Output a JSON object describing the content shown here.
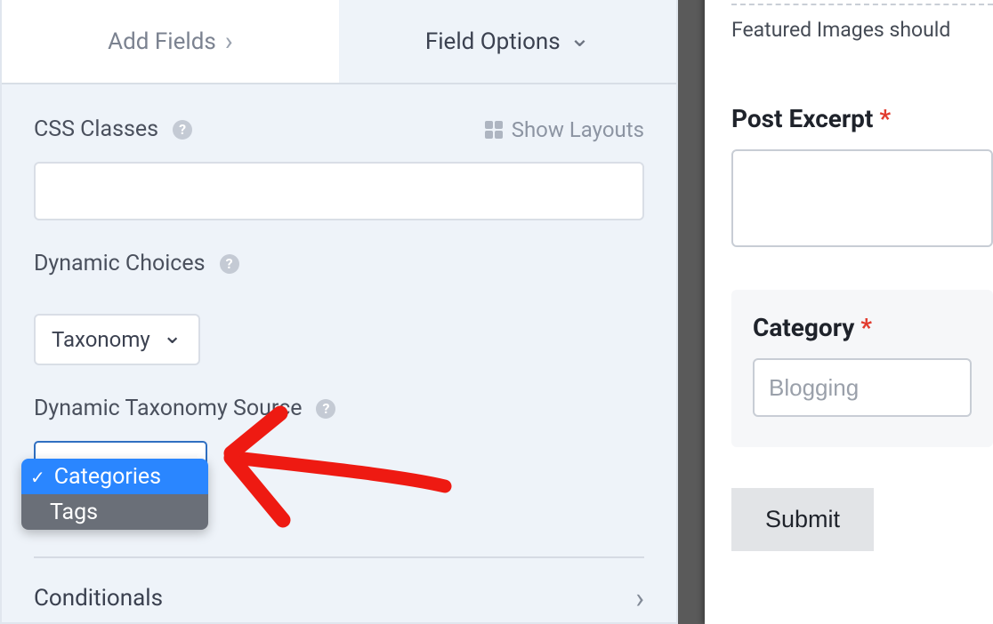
{
  "tabs": {
    "add_fields": "Add Fields",
    "field_options": "Field Options"
  },
  "css_classes": {
    "label": "CSS Classes",
    "show_layouts": "Show Layouts",
    "value": ""
  },
  "dynamic_choices": {
    "label": "Dynamic Choices",
    "selected": "Taxonomy"
  },
  "dynamic_taxonomy_source": {
    "label": "Dynamic Taxonomy Source",
    "options": [
      "Categories",
      "Tags"
    ],
    "selected": "Categories"
  },
  "conditionals": {
    "label": "Conditionals"
  },
  "preview": {
    "featured_helper": "Featured Images should",
    "post_excerpt_label": "Post Excerpt",
    "category_label": "Category",
    "category_value": "Blogging",
    "submit_label": "Submit"
  }
}
